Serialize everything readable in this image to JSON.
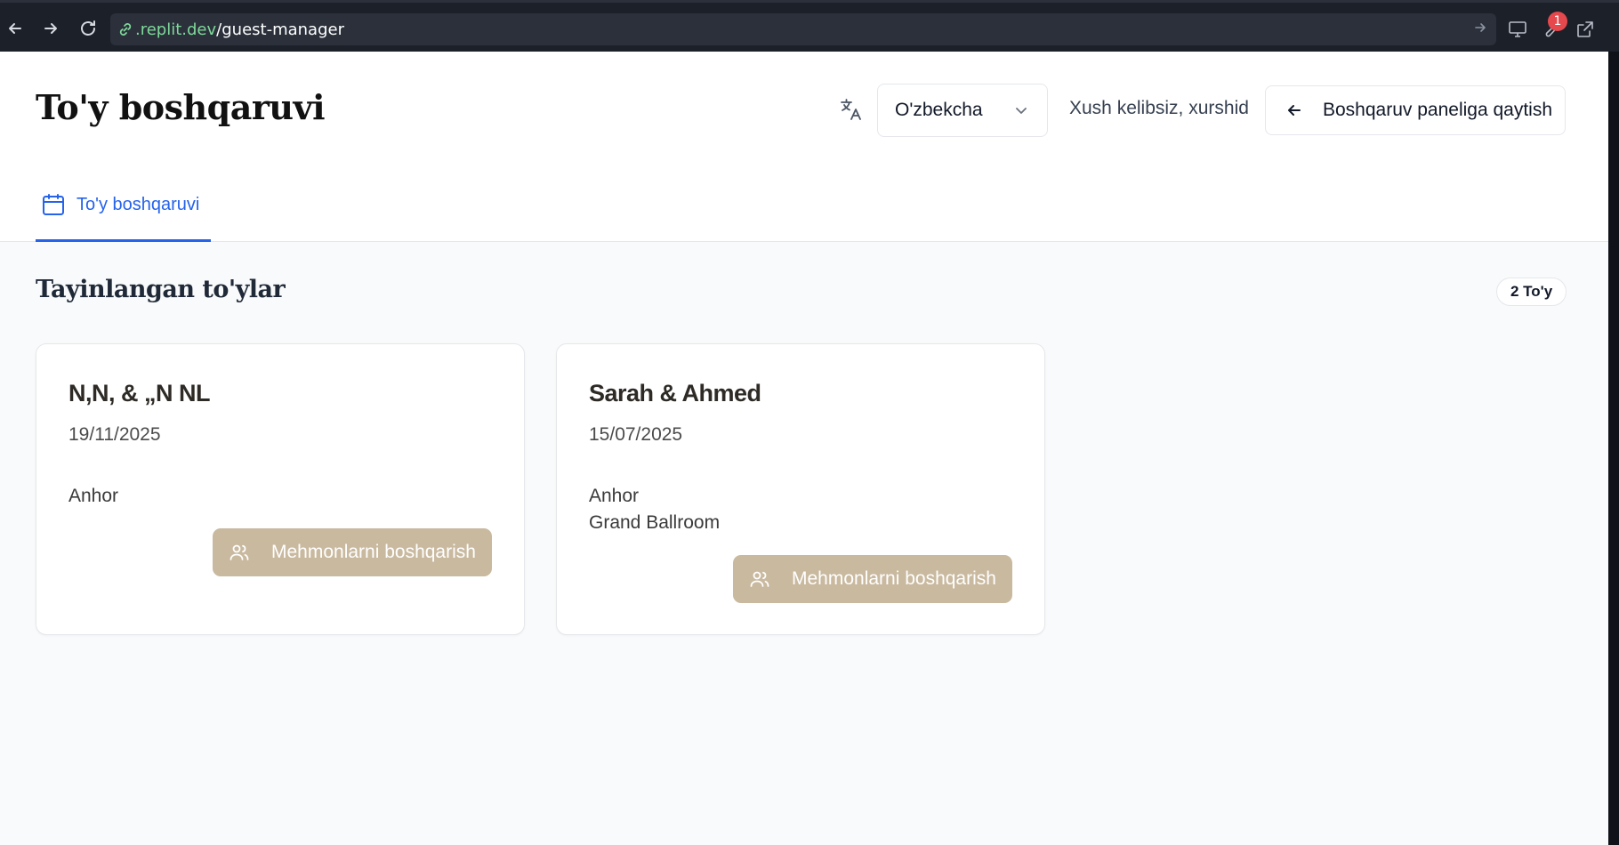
{
  "browser": {
    "url_host": ".replit.dev",
    "url_path": "/guest-manager",
    "notification_count": "1"
  },
  "header": {
    "title": "To'y boshqaruvi",
    "language": {
      "selected": "O'zbekcha"
    },
    "welcome": "Xush kelibsiz, xurshid",
    "back_button": "Boshqaruv paneliga qaytish"
  },
  "tabs": [
    {
      "label": "To'y boshqaruvi",
      "icon": "calendar-icon",
      "active": true
    }
  ],
  "section": {
    "title": "Tayinlangan to'ylar",
    "count_badge": "2 To'y"
  },
  "weddings": [
    {
      "name": "N,N, & „N NL",
      "date": "19/11/2025",
      "venue_lines": [
        "Anhor"
      ],
      "button": "Mehmonlarni boshqarish"
    },
    {
      "name": "Sarah & Ahmed",
      "date": "15/07/2025",
      "venue_lines": [
        "Anhor",
        "Grand Ballroom"
      ],
      "button": "Mehmonlarni boshqarish"
    }
  ],
  "colors": {
    "accent": "#2563eb",
    "button_bg": "#c9b99f",
    "browser_bg": "#1c2029",
    "page_bg": "#f9fafb"
  }
}
